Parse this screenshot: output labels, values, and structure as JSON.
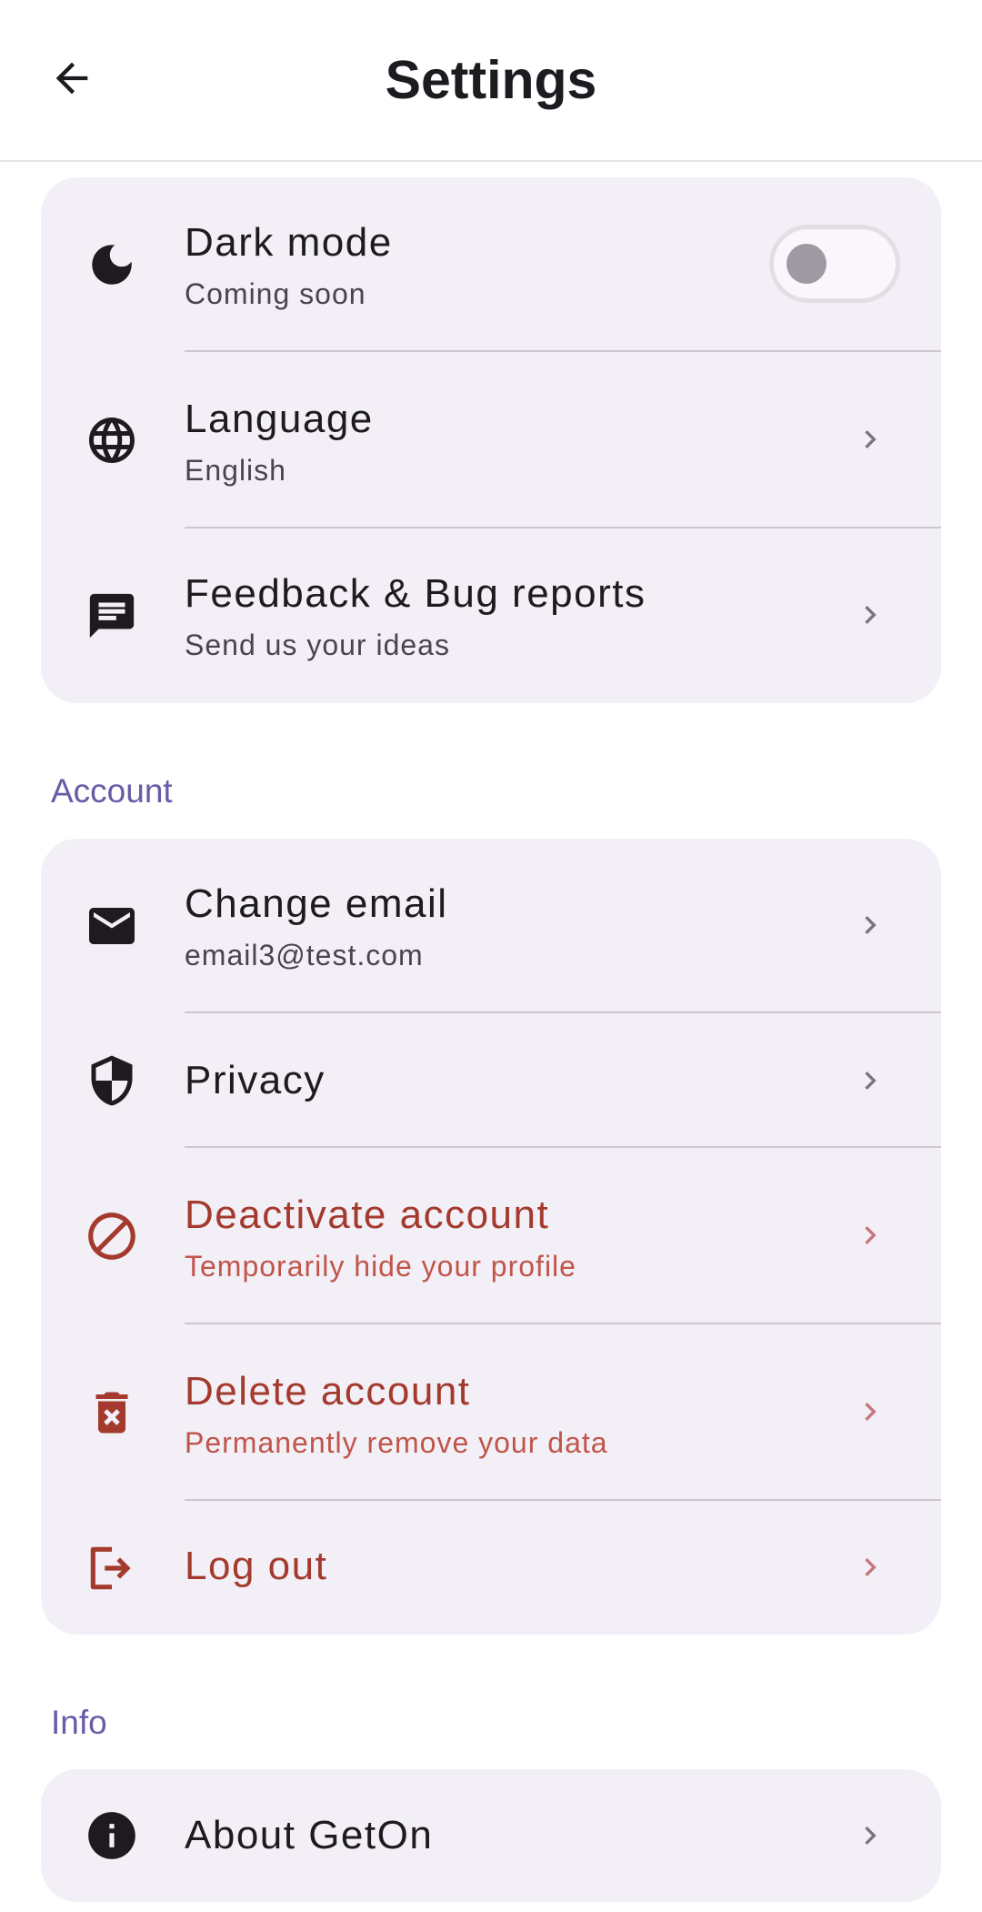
{
  "header": {
    "title": "Settings"
  },
  "general": {
    "dark_mode": {
      "title": "Dark mode",
      "subtitle": "Coming soon",
      "enabled": false
    },
    "language": {
      "title": "Language",
      "subtitle": "English"
    },
    "feedback": {
      "title": "Feedback & Bug reports",
      "subtitle": "Send us your ideas"
    }
  },
  "account": {
    "section_label": "Account",
    "change_email": {
      "title": "Change email",
      "subtitle": "email3@test.com"
    },
    "privacy": {
      "title": "Privacy"
    },
    "deactivate": {
      "title": "Deactivate account",
      "subtitle": "Temporarily hide your profile"
    },
    "delete": {
      "title": "Delete account",
      "subtitle": "Permanently remove your data"
    },
    "logout": {
      "title": "Log out"
    }
  },
  "info": {
    "section_label": "Info",
    "about": {
      "title": "About GetOn"
    }
  },
  "colors": {
    "danger": "#a33a2d",
    "accent": "#6b5aa6",
    "card_background": "#f3eff7"
  }
}
